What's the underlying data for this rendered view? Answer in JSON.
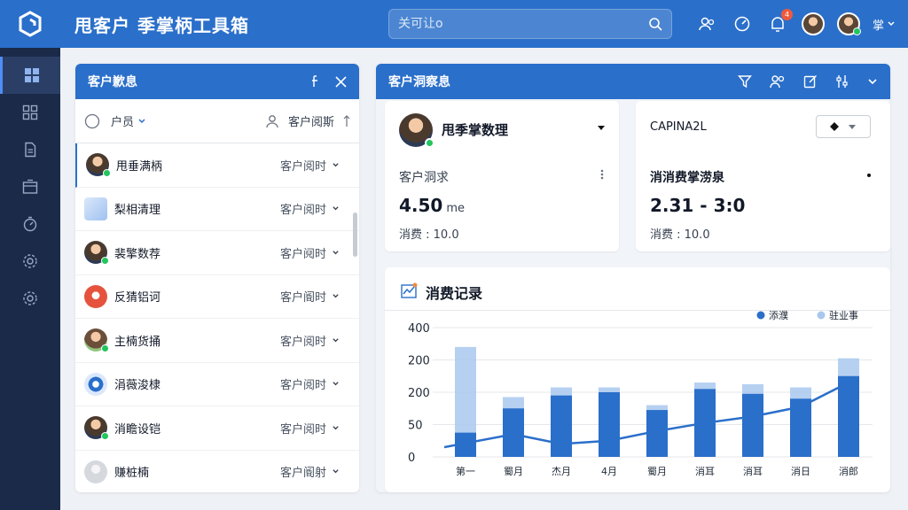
{
  "app": {
    "title": "甩客户 季掌柄工具箱"
  },
  "search": {
    "placeholder": "关可让o"
  },
  "header": {
    "notification_count": "4",
    "user_label": "掌"
  },
  "left_panel": {
    "title": "客户歉息",
    "header_left": "户员",
    "header_right": "客户阅斯",
    "rows": [
      {
        "name": "甩垂满柄",
        "status": "客户阅时",
        "avatar": "person",
        "active": true
      },
      {
        "name": "梨相清理",
        "status": "客户阅时",
        "avatar": "card",
        "active": false
      },
      {
        "name": "裴擎数荐",
        "status": "客户阋时",
        "avatar": "person",
        "active": false
      },
      {
        "name": "反猜铝诃",
        "status": "客户阍时",
        "avatar": "red",
        "active": false
      },
      {
        "name": "主楠货捅",
        "status": "客户阅时",
        "avatar": "person2",
        "active": false
      },
      {
        "name": "涓薇浚棣",
        "status": "客户阅时",
        "avatar": "gear",
        "active": false
      },
      {
        "name": "消瞻设铠",
        "status": "客户阅时",
        "avatar": "person",
        "active": false
      },
      {
        "name": "赚桩楠",
        "status": "客户阍射",
        "avatar": "grey",
        "active": false
      }
    ]
  },
  "right_panel": {
    "title": "客户洞察息",
    "card1": {
      "name": "甩季掌数理",
      "label": "客户洞求",
      "value": "4.50",
      "value_unit": "me",
      "spend": "消费 : 10.0"
    },
    "card2": {
      "title": "CAPINA2L",
      "label": "消消费掌涝泉",
      "value": "2.31 - 3:0",
      "spend": "消费 : 10.0"
    },
    "chart_title": "消费记录"
  },
  "chart_data": {
    "type": "bar",
    "categories": [
      "第一",
      "蜀月",
      "杰月",
      "4月",
      "蜀月",
      "消耳",
      "消耳",
      "消日",
      "消郎"
    ],
    "series": [
      {
        "name": "添濮",
        "values": [
          75,
          150,
          190,
          200,
          145,
          210,
          195,
          180,
          250
        ],
        "color": "#2a6fca"
      },
      {
        "name": "驻业事",
        "values": [
          340,
          185,
          215,
          215,
          160,
          230,
          225,
          215,
          305
        ],
        "color": "#a9c8ee"
      }
    ],
    "line": [
      30,
      70,
      40,
      50,
      80,
      105,
      125,
      155,
      230
    ],
    "yticks": [
      "0",
      "50",
      "200",
      "200",
      "400"
    ],
    "ylim": [
      0,
      400
    ]
  }
}
